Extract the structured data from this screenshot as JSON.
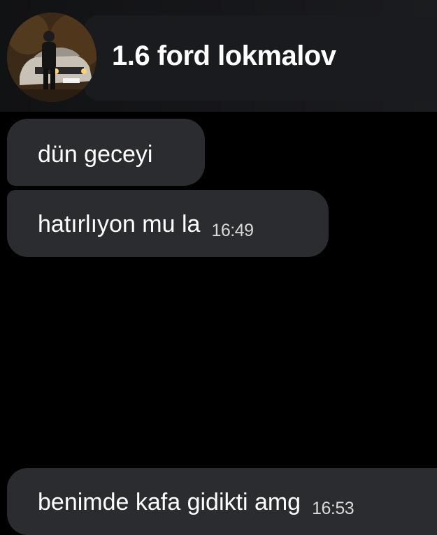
{
  "header": {
    "contact_name": "1.6 ford lokmalov",
    "avatar_icon": "profile-photo-car-night"
  },
  "messages": [
    {
      "text": "dün geceyi",
      "time": ""
    },
    {
      "text": "hatırlıyon mu la",
      "time": "16:49"
    },
    {
      "text": "benimde kafa gidikti amg",
      "time": "16:53"
    }
  ],
  "colors": {
    "background": "#000000",
    "bubble": "#2b2c30",
    "header": "#1a1b1e",
    "text": "#ffffff"
  }
}
